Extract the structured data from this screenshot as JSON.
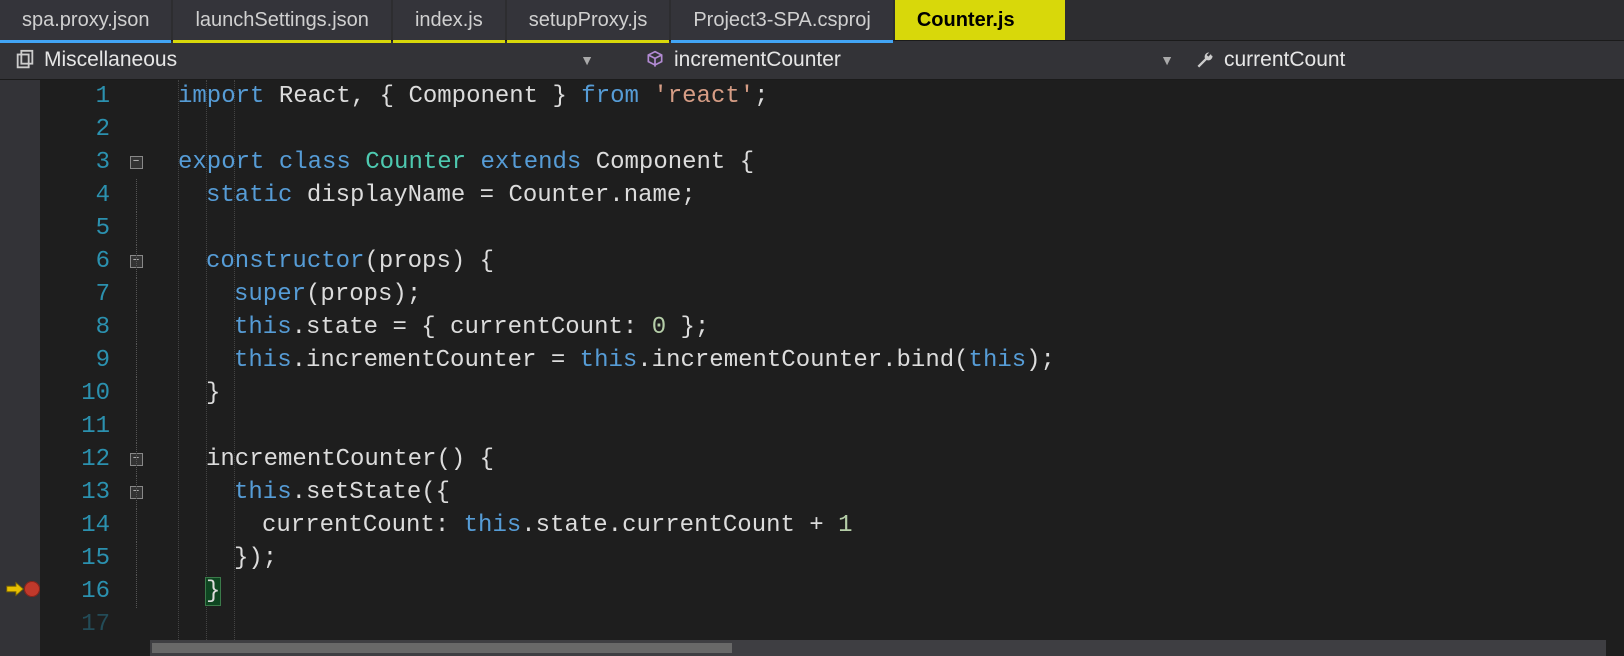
{
  "tabs": [
    {
      "label": "spa.proxy.json",
      "underline": "blue"
    },
    {
      "label": "launchSettings.json",
      "underline": "yellow"
    },
    {
      "label": "index.js",
      "underline": "yellow"
    },
    {
      "label": "setupProxy.js",
      "underline": "yellow"
    },
    {
      "label": "Project3-SPA.csproj",
      "underline": "blue"
    },
    {
      "label": "Counter.js",
      "underline": "",
      "active": true
    }
  ],
  "navbar": {
    "scope": "Miscellaneous",
    "method": "incrementCounter",
    "member": "currentCount"
  },
  "lineNumbers": [
    "1",
    "2",
    "3",
    "4",
    "5",
    "6",
    "7",
    "8",
    "9",
    "10",
    "11",
    "12",
    "13",
    "14",
    "15",
    "16",
    "17"
  ],
  "code": {
    "l1": {
      "t1": "import",
      "t2": " React",
      "t3": ",",
      "t4": " {",
      "t5": " Component ",
      "t6": "}",
      "t7": " from ",
      "t8": "'react'",
      "t9": ";"
    },
    "l3": {
      "t1": "export",
      "t2": " class ",
      "t3": "Counter",
      "t4": " extends ",
      "t5": "Component ",
      "t6": "{"
    },
    "l4": {
      "t1": "static",
      "t2": " displayName ",
      "t3": "=",
      "t4": " Counter",
      "t5": ".",
      "t6": "name",
      "t7": ";"
    },
    "l6": {
      "t1": "constructor",
      "t2": "(props) {"
    },
    "l7": {
      "t1": "super",
      "t2": "(props);"
    },
    "l8": {
      "t1": "this",
      "t2": ".state ",
      "t3": "=",
      "t4": " { currentCount: ",
      "t5": "0",
      "t6": " };"
    },
    "l9": {
      "t1": "this",
      "t2": ".incrementCounter ",
      "t3": "=",
      "t4": " ",
      "t5": "this",
      "t6": ".incrementCounter.bind(",
      "t7": "this",
      "t8": ");"
    },
    "l10": {
      "t1": "}"
    },
    "l12": {
      "t1": "incrementCounter() {"
    },
    "l13": {
      "t1": "this",
      "t2": ".setState({"
    },
    "l14": {
      "t1": "currentCount: ",
      "t2": "this",
      "t3": ".state.currentCount ",
      "t4": "+",
      "t5": " 1"
    },
    "l15": {
      "t1": "});"
    },
    "l16": {
      "t1": "}"
    }
  },
  "fold": {
    "minus": "−"
  }
}
